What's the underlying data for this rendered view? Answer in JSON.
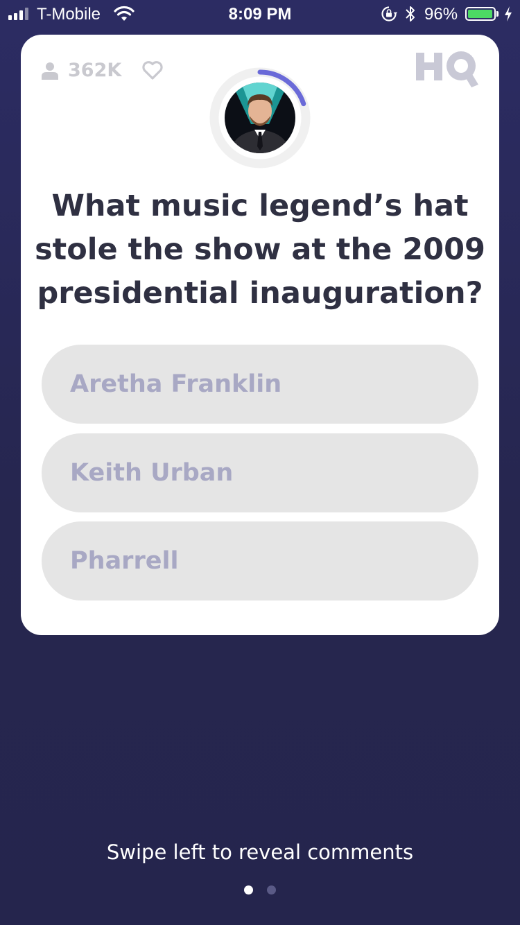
{
  "status_bar": {
    "carrier": "T-Mobile",
    "time": "8:09 PM",
    "battery_percent": "96%",
    "battery_level": 0.96,
    "signal_bars": 3,
    "icons": [
      "signal-icon",
      "wifi-icon",
      "rotation-lock-icon",
      "bluetooth-icon",
      "battery-icon",
      "charging-icon"
    ]
  },
  "card": {
    "viewer_count": "362K",
    "logo": "HQ",
    "timer_progress": 0.2,
    "host_avatar": "host-avatar",
    "question": "What music legend’s hat stole the show at the 2009 presidential inauguration?",
    "answers": [
      {
        "label": "Aretha Franklin"
      },
      {
        "label": "Keith Urban"
      },
      {
        "label": "Pharrell"
      }
    ]
  },
  "footer": {
    "hint": "Swipe left to reveal comments",
    "page_count": 2,
    "active_page": 1
  },
  "colors": {
    "background": "#2a2a5c",
    "card": "#ffffff",
    "answer_bg": "#e5e5e5",
    "answer_text": "#a8a8c4",
    "question_text": "#2f3042",
    "timer_arc": "#6a6ad8",
    "battery": "#4cd964"
  }
}
